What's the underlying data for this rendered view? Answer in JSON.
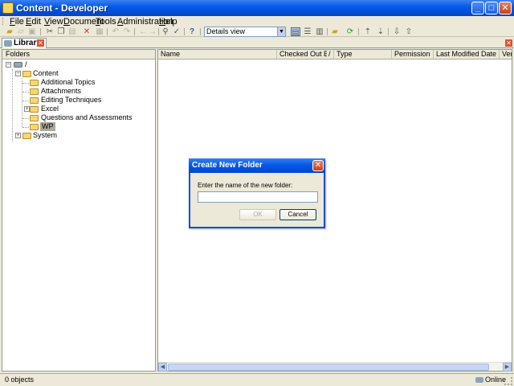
{
  "window": {
    "title": "Content - Developer",
    "minimize_label": "_",
    "maximize_label": "□",
    "close_label": "✕"
  },
  "menu": [
    {
      "mnemonic": "F",
      "rest": "ile"
    },
    {
      "mnemonic": "E",
      "rest": "dit"
    },
    {
      "mnemonic": "V",
      "rest": "iew"
    },
    {
      "mnemonic": "D",
      "rest": "ocument"
    },
    {
      "mnemonic": "T",
      "rest": "ools"
    },
    {
      "mnemonic": "A",
      "rest": "dministration"
    },
    {
      "mnemonic": "H",
      "rest": "elp"
    }
  ],
  "toolbar": {
    "view_select": "Details view",
    "icons": [
      "new-folder-icon",
      "open-icon",
      "save-icon",
      "cut-icon",
      "copy-icon",
      "paste-icon",
      "delete-icon",
      "properties-icon",
      "undo-icon",
      "redo-icon",
      "back-icon",
      "forward-icon",
      "find-icon",
      "spell-icon",
      "help-icon",
      "details-view-icon",
      "list-view-icon",
      "split-view-icon",
      "publish-icon",
      "refresh-icon",
      "check-in-icon",
      "check-out-icon",
      "import-icon",
      "export-icon"
    ]
  },
  "tab": {
    "label": "Library",
    "close_label": "✕"
  },
  "panel_close_label": "✕",
  "folders_panel": {
    "header": "Folders",
    "tree": [
      {
        "label": "/",
        "expander": "−"
      },
      {
        "label": "Content",
        "expander": "−"
      },
      {
        "label": "Additional Topics"
      },
      {
        "label": "Attachments"
      },
      {
        "label": "Editing Techniques"
      },
      {
        "label": "Excel",
        "expander": "+"
      },
      {
        "label": "Questions and Assessments"
      },
      {
        "label": "WP",
        "selected": true
      },
      {
        "label": "System",
        "expander": "+"
      }
    ]
  },
  "list_panel": {
    "columns": [
      "Name",
      "Checked Out By",
      "/",
      "Type",
      "Permission",
      "Last Modified Date",
      "Ver"
    ]
  },
  "status": {
    "objects": "0 objects",
    "connection": "Online"
  },
  "dialog": {
    "title": "Create New Folder",
    "prompt": "Enter the name of the new folder:",
    "input_value": "",
    "ok_label": "OK",
    "cancel_label": "Cancel",
    "close_label": "✕"
  }
}
